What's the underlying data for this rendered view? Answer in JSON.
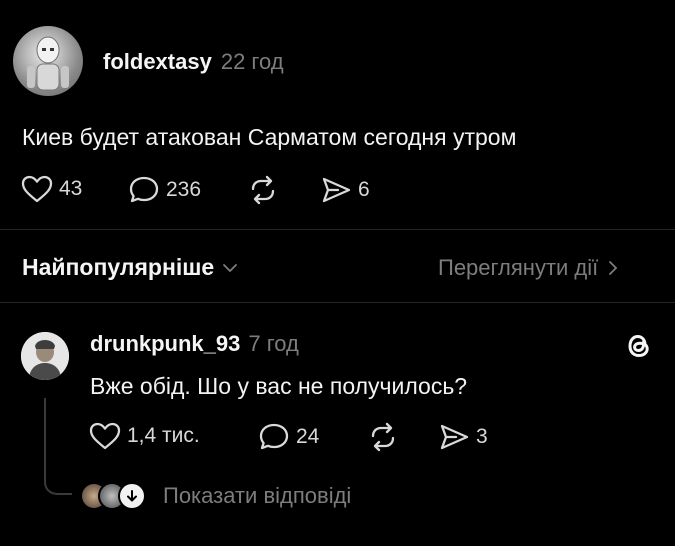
{
  "post": {
    "username": "foldextasy",
    "time": "22 год",
    "text": "Киев будет атакован Сарматом сегодня утром",
    "likes": "43",
    "comments": "236",
    "shares": "6"
  },
  "sort": {
    "label": "Найпопулярніше",
    "view_activity": "Переглянути дії"
  },
  "reply": {
    "username": "drunkpunk_93",
    "time": "7 год",
    "text": "Вже обід. Шо у вас не получилось?",
    "likes": "1,4 тис.",
    "comments": "24",
    "shares": "3",
    "show_replies": "Показати відповіді"
  },
  "colors": {
    "background": "#000000",
    "text": "#f3f3f3",
    "muted": "#7d7d7d",
    "divider": "#262626"
  },
  "icons": [
    "heart-icon",
    "comment-icon",
    "repost-icon",
    "send-icon",
    "chevron-down-icon",
    "chevron-right-icon",
    "threads-logo-icon",
    "arrow-down-icon"
  ]
}
